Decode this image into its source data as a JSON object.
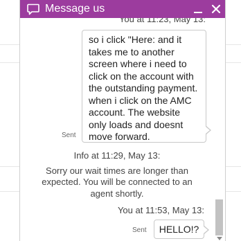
{
  "colors": {
    "header_bg": "#9c3c9e",
    "page_bg": "#ffffff"
  },
  "header": {
    "icon": "chat-bubble-icon",
    "title": "Message us",
    "minimize_icon": "minimize-icon",
    "close_icon": "close-icon"
  },
  "messages": [
    {
      "type": "timestamp",
      "text": "You at 11:23, May 13:"
    },
    {
      "type": "sent",
      "status": "Sent",
      "text": "so i click \"Here: and it takes me to another screen where i need to click on the account with the outstanding payment. when i click on the AMC account. The website only loads and doesnt move forward."
    },
    {
      "type": "info",
      "heading": "Info at 11:29, May 13:",
      "text": "Sorry our wait times are longer than expected. You will be connected to an agent shortly."
    },
    {
      "type": "timestamp",
      "text": "You at 11:53, May 13:"
    },
    {
      "type": "sent",
      "status": "Sent",
      "text": "HELLO!?"
    }
  ]
}
